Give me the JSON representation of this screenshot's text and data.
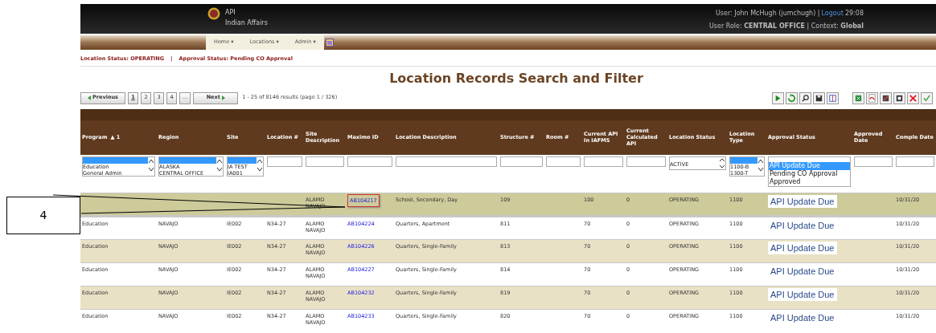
{
  "header": {
    "app_name": "API",
    "org_name": "Indian Affairs",
    "user_line": "User: John McHugh (jumchugh) |",
    "logout": "Logout",
    "timer": "29:08",
    "role_line": "User Role: **CENTRAL OFFICE** | Context: **Global**"
  },
  "nav": {
    "items": [
      "Home ▾",
      "Locations ▾",
      "Admin ▾"
    ]
  },
  "status_line": {
    "location_status": "Location Status: OPERATING",
    "separator": "|",
    "approval_status": "Approval Status: Pending CO Approval"
  },
  "title": "Location Records Search and Filter",
  "pagination": {
    "previous": "Previous",
    "pages": [
      {
        "label": "1",
        "selected": true
      },
      {
        "label": "2",
        "selected": false
      },
      {
        "label": "3",
        "selected": false
      },
      {
        "label": "4",
        "selected": false
      },
      {
        "label": "...",
        "selected": false
      }
    ],
    "next": "Next",
    "summary": "1 -  25 of  8146 results (page  1 /  326)"
  },
  "table": {
    "columns": [
      {
        "label": "Program",
        "sort": "▲ 1",
        "filter": {
          "kind": "listbox",
          "empty_option_selected": true,
          "options": [
            "Education",
            "General Admin"
          ]
        }
      },
      {
        "label": "Region",
        "filter": {
          "kind": "listbox",
          "empty_option_selected": true,
          "options": [
            "ALASKA",
            "CENTRAL OFFICE"
          ]
        }
      },
      {
        "label": "Site",
        "filter": {
          "kind": "listbox",
          "empty_option_selected": true,
          "options": [
            "IA TEST",
            "IA001"
          ]
        }
      },
      {
        "label": "Location #",
        "filter": {
          "kind": "text"
        }
      },
      {
        "label": "Site Description",
        "filter": {
          "kind": "text"
        }
      },
      {
        "label": "Maximo ID",
        "filter": {
          "kind": "text"
        }
      },
      {
        "label": "Location Description",
        "filter": {
          "kind": "text"
        }
      },
      {
        "label": "Structure #",
        "filter": {
          "kind": "text"
        }
      },
      {
        "label": "Room #",
        "filter": {
          "kind": "text"
        }
      },
      {
        "label": "Current API In IAFMS",
        "filter": {
          "kind": "text"
        }
      },
      {
        "label": "Current Calculated API",
        "filter": {
          "kind": "text"
        }
      },
      {
        "label": "Location Status",
        "filter": {
          "kind": "spinner",
          "value": "ACTIVE"
        }
      },
      {
        "label": "Location Type",
        "filter": {
          "kind": "listbox",
          "empty_option_selected": true,
          "options": [
            "1100-B",
            "1300-T"
          ]
        }
      },
      {
        "label": "Approval Status",
        "filter": {
          "kind": "dropdown",
          "options": [
            {
              "label": "API Update Due",
              "selected": true
            },
            {
              "label": "Pending CO Approval",
              "selected": false
            },
            {
              "label": "Approved",
              "selected": false
            }
          ]
        }
      },
      {
        "label": "Approved Date",
        "filter": {
          "kind": "text"
        }
      },
      {
        "label": "Comple Date",
        "filter": {
          "kind": "text"
        }
      }
    ],
    "rows": [
      {
        "selected": true,
        "callout": true,
        "site_description": "ALAMO NAVAJO",
        "maximo_id": "AB104217",
        "location_description": "School, Secondary, Day",
        "structure": "109",
        "current_api": "100",
        "calculated_api": "0",
        "location_status": "OPERATING",
        "location_type": "1100",
        "approval_status": "API Update Due",
        "completed_date": "10/31/20"
      },
      {
        "selected": false,
        "callout": false,
        "program": "Education",
        "region": "NAVAJO",
        "site": "IE002",
        "location": "N34-27",
        "site_description": "ALAMO NAVAJO",
        "maximo_id": "AB104224",
        "location_description": "Quarters, Apartment",
        "structure": "811",
        "current_api": "70",
        "calculated_api": "0",
        "location_status": "OPERATING",
        "location_type": "1100",
        "approval_status": "API Update Due",
        "completed_date": "10/31/20"
      },
      {
        "selected": false,
        "callout": false,
        "program": "Education",
        "region": "NAVAJO",
        "site": "IE002",
        "location": "N34-27",
        "site_description": "ALAMO NAVAJO",
        "maximo_id": "AB104226",
        "location_description": "Quarters, Single-Family",
        "structure": "813",
        "current_api": "70",
        "calculated_api": "0",
        "location_status": "OPERATING",
        "location_type": "1100",
        "approval_status": "API Update Due",
        "completed_date": "10/31/20"
      },
      {
        "selected": false,
        "callout": false,
        "program": "Education",
        "region": "NAVAJO",
        "site": "IE002",
        "location": "N34-27",
        "site_description": "ALAMO NAVAJO",
        "maximo_id": "AB104227",
        "location_description": "Quarters, Single-Family",
        "structure": "814",
        "current_api": "70",
        "calculated_api": "0",
        "location_status": "OPERATING",
        "location_type": "1100",
        "approval_status": "API Update Due",
        "completed_date": "10/31/20"
      },
      {
        "selected": false,
        "callout": false,
        "program": "Education",
        "region": "NAVAJO",
        "site": "IE002",
        "location": "N34-27",
        "site_description": "ALAMO NAVAJO",
        "maximo_id": "AB104232",
        "location_description": "Quarters, Single-Family",
        "structure": "819",
        "current_api": "70",
        "calculated_api": "0",
        "location_status": "OPERATING",
        "location_type": "1100",
        "approval_status": "API Update Due",
        "completed_date": "10/31/20"
      },
      {
        "selected": false,
        "callout": false,
        "program": "Education",
        "region": "NAVAJO",
        "site": "IE002",
        "location": "N34-27",
        "site_description": "ALAMO NAVAJO",
        "maximo_id": "AB104233",
        "location_description": "Quarters, Single-Family",
        "structure": "820",
        "current_api": "70",
        "calculated_api": "0",
        "location_status": "OPERATING",
        "location_type": "1100",
        "approval_status": "API Update Due",
        "completed_date": "10/31/20"
      }
    ]
  },
  "callout": {
    "label": "4"
  }
}
